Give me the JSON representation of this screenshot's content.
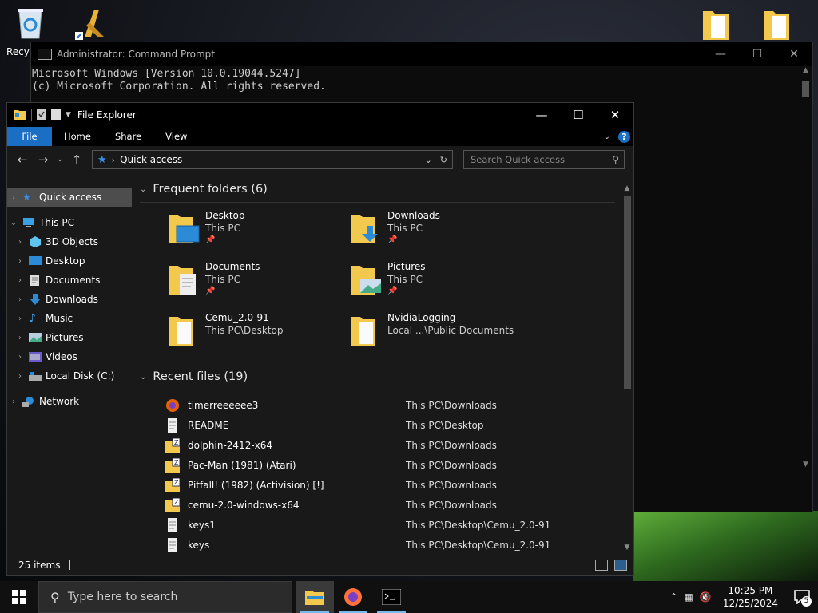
{
  "desktop": {
    "recycle_label": "Recyc"
  },
  "cmd": {
    "title": "Administrator: Command Prompt",
    "lines": [
      "Microsoft Windows [Version 10.0.19044.5247]",
      "(c) Microsoft Corporation. All rights reserved."
    ]
  },
  "explorer": {
    "title": "File Explorer",
    "ribbon": {
      "file": "File",
      "home": "Home",
      "share": "Share",
      "view": "View"
    },
    "address": {
      "location": "Quick access"
    },
    "search": {
      "placeholder": "Search Quick access"
    },
    "nav": {
      "quick_access": "Quick access",
      "this_pc": "This PC",
      "objects3d": "3D Objects",
      "desktop": "Desktop",
      "documents": "Documents",
      "downloads": "Downloads",
      "music": "Music",
      "pictures": "Pictures",
      "videos": "Videos",
      "local_disk": "Local Disk (C:)",
      "network": "Network"
    },
    "frequent_header": "Frequent folders (6)",
    "frequent": [
      {
        "name": "Desktop",
        "path": "This PC"
      },
      {
        "name": "Downloads",
        "path": "This PC"
      },
      {
        "name": "Documents",
        "path": "This PC"
      },
      {
        "name": "Pictures",
        "path": "This PC"
      },
      {
        "name": "Cemu_2.0-91",
        "path": "This PC\\Desktop"
      },
      {
        "name": "NvidiaLogging",
        "path": "Local ...\\Public Documents"
      }
    ],
    "recent_header": "Recent files (19)",
    "recent": [
      {
        "name": "timerreeeeee3",
        "location": "This PC\\Downloads"
      },
      {
        "name": "README",
        "location": "This PC\\Desktop"
      },
      {
        "name": "dolphin-2412-x64",
        "location": "This PC\\Downloads"
      },
      {
        "name": "Pac-Man (1981) (Atari)",
        "location": "This PC\\Downloads"
      },
      {
        "name": "Pitfall! (1982) (Activision) [!]",
        "location": "This PC\\Downloads"
      },
      {
        "name": "cemu-2.0-windows-x64",
        "location": "This PC\\Downloads"
      },
      {
        "name": "keys1",
        "location": "This PC\\Desktop\\Cemu_2.0-91"
      },
      {
        "name": "keys",
        "location": "This PC\\Desktop\\Cemu_2.0-91"
      }
    ],
    "status": {
      "count": "25 items"
    }
  },
  "taskbar": {
    "search_placeholder": "Type here to search",
    "time": "10:25 PM",
    "date": "12/25/2024",
    "notification_count": "5"
  },
  "colors": {
    "accent": "#1a6fc4",
    "folder": "#f2c94c"
  }
}
